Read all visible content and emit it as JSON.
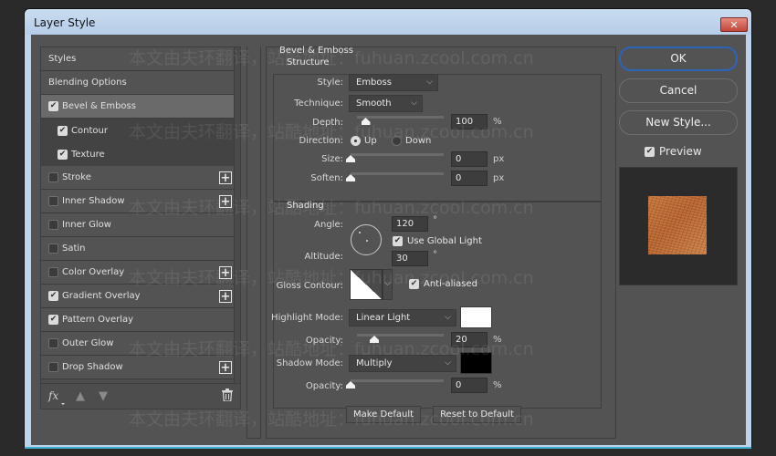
{
  "window": {
    "title": "Layer Style",
    "close_label": "✕"
  },
  "styles_panel": {
    "items": [
      {
        "label": "Styles",
        "type": "header"
      },
      {
        "label": "Blending Options",
        "type": "header"
      },
      {
        "label": "Bevel & Emboss",
        "checked": true,
        "selected": true,
        "add": false
      },
      {
        "label": "Contour",
        "checked": true,
        "sub": true
      },
      {
        "label": "Texture",
        "checked": true,
        "sub": true
      },
      {
        "label": "Stroke",
        "checked": false,
        "add": true
      },
      {
        "label": "Inner Shadow",
        "checked": false,
        "add": true
      },
      {
        "label": "Inner Glow",
        "checked": false,
        "add": false
      },
      {
        "label": "Satin",
        "checked": false,
        "add": false
      },
      {
        "label": "Color Overlay",
        "checked": false,
        "add": true
      },
      {
        "label": "Gradient Overlay",
        "checked": true,
        "add": true
      },
      {
        "label": "Pattern Overlay",
        "checked": true,
        "add": false
      },
      {
        "label": "Outer Glow",
        "checked": false,
        "add": false
      },
      {
        "label": "Drop Shadow",
        "checked": false,
        "add": true
      }
    ],
    "footer": {
      "fx_label": "fx",
      "up_icon": "▲",
      "down_icon": "▼",
      "trash_icon": "🗑"
    }
  },
  "bevel": {
    "section_title": "Bevel & Emboss",
    "structure": {
      "title": "Structure",
      "style_label": "Style:",
      "style_value": "Emboss",
      "technique_label": "Technique:",
      "technique_value": "Smooth",
      "depth_label": "Depth:",
      "depth_value": "100",
      "depth_unit": "%",
      "depth_percent": 100,
      "direction_label": "Direction:",
      "direction_up": "Up",
      "direction_down": "Down",
      "direction_selected": "Up",
      "size_label": "Size:",
      "size_value": "0",
      "size_unit": "px",
      "soften_label": "Soften:",
      "soften_value": "0",
      "soften_unit": "px"
    },
    "shading": {
      "title": "Shading",
      "angle_label": "Angle:",
      "angle_value": "120",
      "angle_unit": "°",
      "global_light_label": "Use Global Light",
      "global_light_checked": true,
      "altitude_label": "Altitude:",
      "altitude_value": "30",
      "altitude_unit": "°",
      "gloss_contour_label": "Gloss Contour:",
      "anti_aliased_label": "Anti-aliased",
      "anti_aliased_checked": true,
      "highlight_mode_label": "Highlight Mode:",
      "highlight_mode_value": "Linear Light",
      "highlight_color": "#ffffff",
      "highlight_opacity_label": "Opacity:",
      "highlight_opacity_value": "20",
      "highlight_opacity_unit": "%",
      "shadow_mode_label": "Shadow Mode:",
      "shadow_mode_value": "Multiply",
      "shadow_color": "#000000",
      "shadow_opacity_label": "Opacity:",
      "shadow_opacity_value": "0",
      "shadow_opacity_unit": "%"
    },
    "make_default_label": "Make Default",
    "reset_default_label": "Reset to Default"
  },
  "actions": {
    "ok_label": "OK",
    "cancel_label": "Cancel",
    "new_style_label": "New Style...",
    "preview_label": "Preview",
    "preview_checked": true
  },
  "watermark": {
    "line1": "本文由夫环翻译，站酷地址：fuhuan.zcool.com.cn"
  },
  "chevron": "⌵"
}
